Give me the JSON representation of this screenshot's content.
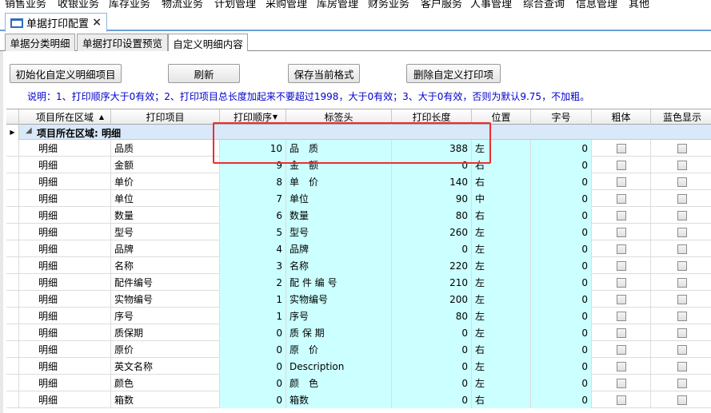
{
  "menubar": {
    "items": [
      "销售业务",
      "收银业务",
      "库存业务",
      "物流业务",
      "计划管理",
      "采购管理",
      "库房管理",
      "财务业务",
      "客户服务",
      "人事管理",
      "综合查询",
      "信息管理",
      "其他"
    ]
  },
  "doc_tab": {
    "label": "单据打印配置",
    "close": "×"
  },
  "sub_tabs": [
    "单据分类明细",
    "单据打印设置预览",
    "自定义明细内容"
  ],
  "toolbar": {
    "init_label": "初始化自定义明细项目",
    "refresh_label": "刷新",
    "save_label": "保存当前格式",
    "delete_label": "删除自定义打印项"
  },
  "note": "说明：1、打印顺序大于0有效；2、打印项目总长度加起来不要超过1998，大于0有效；3、大于0有效，否则为默认9.75，不加粗。",
  "grid": {
    "columns": [
      "项目所在区域",
      "打印项目",
      "打印顺序",
      "标签头",
      "打印长度",
      "位置",
      "字号",
      "粗体",
      "蓝色显示"
    ],
    "group_label": "项目所在区域: 明细",
    "rows": [
      [
        "明细",
        "品质",
        "10",
        "品　质",
        "388",
        "左",
        "0"
      ],
      [
        "明细",
        "金额",
        "9",
        "金　额",
        "0",
        "右",
        "0"
      ],
      [
        "明细",
        "单价",
        "8",
        "单　价",
        "140",
        "右",
        "0"
      ],
      [
        "明细",
        "单位",
        "7",
        "单位",
        "90",
        "中",
        "0"
      ],
      [
        "明细",
        "数量",
        "6",
        "数量",
        "80",
        "右",
        "0"
      ],
      [
        "明细",
        "型号",
        "5",
        "型号",
        "260",
        "左",
        "0"
      ],
      [
        "明细",
        "品牌",
        "4",
        "品牌",
        "0",
        "左",
        "0"
      ],
      [
        "明细",
        "名称",
        "3",
        "名称",
        "220",
        "左",
        "0"
      ],
      [
        "明细",
        "配件编号",
        "2",
        "配 件 编 号",
        "210",
        "左",
        "0"
      ],
      [
        "明细",
        "实物编号",
        "1",
        "实物编号",
        "200",
        "左",
        "0"
      ],
      [
        "明细",
        "序号",
        "1",
        "序号",
        "80",
        "左",
        "0"
      ],
      [
        "明细",
        "质保期",
        "0",
        "质 保 期",
        "0",
        "左",
        "0"
      ],
      [
        "明细",
        "原价",
        "0",
        "原　价",
        "0",
        "右",
        "0"
      ],
      [
        "明细",
        "英文名称",
        "0",
        "Description",
        "0",
        "左",
        "0"
      ],
      [
        "明细",
        "颜色",
        "0",
        "颜　色",
        "0",
        "左",
        "0"
      ],
      [
        "明细",
        "箱数",
        "0",
        "箱数",
        "0",
        "右",
        "0"
      ]
    ]
  },
  "colors": {
    "accent": "#2e6bc2",
    "cyan_cell": "#ccffff",
    "group_row": "#d9e9f9",
    "note_text": "#0000cc",
    "highlight": "#e83030"
  }
}
